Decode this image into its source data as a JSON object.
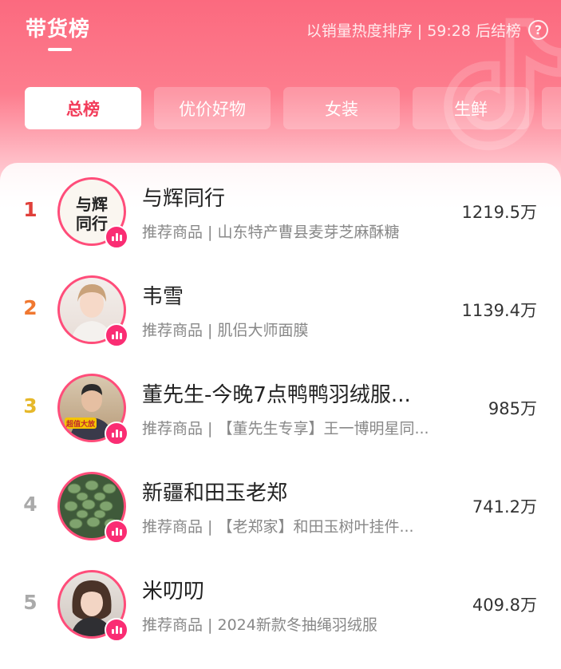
{
  "header": {
    "title": "带货榜",
    "sort_info": "以销量热度排序 | 59:28 后结榜",
    "help_icon": "?"
  },
  "tabs": [
    {
      "label": "总榜",
      "active": true
    },
    {
      "label": "优价好物",
      "active": false
    },
    {
      "label": "女装",
      "active": false
    },
    {
      "label": "生鲜",
      "active": false
    }
  ],
  "ranking": [
    {
      "rank": "1",
      "name": "与辉同行",
      "desc": "推荐商品 | 山东特产曹县麦芽芝麻酥糖",
      "sales": "1219.5万",
      "rank_color": "#e0403a",
      "avatar_text": "与辉同行"
    },
    {
      "rank": "2",
      "name": "韦雪",
      "desc": "推荐商品 | 肌侣大师面膜",
      "sales": "1139.4万",
      "rank_color": "#f07830"
    },
    {
      "rank": "3",
      "name": "董先生-今晚7点鸭鸭羽绒服...",
      "desc": "推荐商品 | 【董先生专享】王一博明星同...",
      "sales": "985万",
      "rank_color": "#e6b82a",
      "avatar_text": "超值大放"
    },
    {
      "rank": "4",
      "name": "新疆和田玉老郑",
      "desc": "推荐商品 | 【老郑家】和田玉树叶挂件...",
      "sales": "741.2万",
      "rank_color": "#aaaaaa"
    },
    {
      "rank": "5",
      "name": "米叨叨",
      "desc": "推荐商品 | 2024新款冬抽绳羽绒服",
      "sales": "409.8万",
      "rank_color": "#aaaaaa"
    }
  ]
}
